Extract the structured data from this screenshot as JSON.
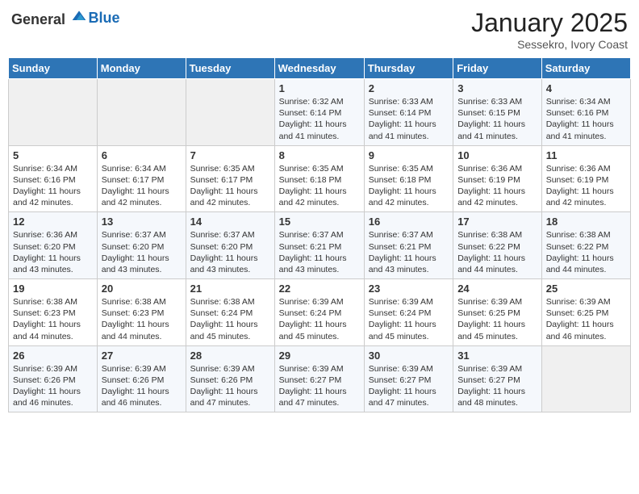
{
  "header": {
    "logo_general": "General",
    "logo_blue": "Blue",
    "month": "January 2025",
    "location": "Sessekro, Ivory Coast"
  },
  "weekdays": [
    "Sunday",
    "Monday",
    "Tuesday",
    "Wednesday",
    "Thursday",
    "Friday",
    "Saturday"
  ],
  "weeks": [
    [
      {
        "day": "",
        "info": ""
      },
      {
        "day": "",
        "info": ""
      },
      {
        "day": "",
        "info": ""
      },
      {
        "day": "1",
        "info": "Sunrise: 6:32 AM\nSunset: 6:14 PM\nDaylight: 11 hours and 41 minutes."
      },
      {
        "day": "2",
        "info": "Sunrise: 6:33 AM\nSunset: 6:14 PM\nDaylight: 11 hours and 41 minutes."
      },
      {
        "day": "3",
        "info": "Sunrise: 6:33 AM\nSunset: 6:15 PM\nDaylight: 11 hours and 41 minutes."
      },
      {
        "day": "4",
        "info": "Sunrise: 6:34 AM\nSunset: 6:16 PM\nDaylight: 11 hours and 41 minutes."
      }
    ],
    [
      {
        "day": "5",
        "info": "Sunrise: 6:34 AM\nSunset: 6:16 PM\nDaylight: 11 hours and 42 minutes."
      },
      {
        "day": "6",
        "info": "Sunrise: 6:34 AM\nSunset: 6:17 PM\nDaylight: 11 hours and 42 minutes."
      },
      {
        "day": "7",
        "info": "Sunrise: 6:35 AM\nSunset: 6:17 PM\nDaylight: 11 hours and 42 minutes."
      },
      {
        "day": "8",
        "info": "Sunrise: 6:35 AM\nSunset: 6:18 PM\nDaylight: 11 hours and 42 minutes."
      },
      {
        "day": "9",
        "info": "Sunrise: 6:35 AM\nSunset: 6:18 PM\nDaylight: 11 hours and 42 minutes."
      },
      {
        "day": "10",
        "info": "Sunrise: 6:36 AM\nSunset: 6:19 PM\nDaylight: 11 hours and 42 minutes."
      },
      {
        "day": "11",
        "info": "Sunrise: 6:36 AM\nSunset: 6:19 PM\nDaylight: 11 hours and 42 minutes."
      }
    ],
    [
      {
        "day": "12",
        "info": "Sunrise: 6:36 AM\nSunset: 6:20 PM\nDaylight: 11 hours and 43 minutes."
      },
      {
        "day": "13",
        "info": "Sunrise: 6:37 AM\nSunset: 6:20 PM\nDaylight: 11 hours and 43 minutes."
      },
      {
        "day": "14",
        "info": "Sunrise: 6:37 AM\nSunset: 6:20 PM\nDaylight: 11 hours and 43 minutes."
      },
      {
        "day": "15",
        "info": "Sunrise: 6:37 AM\nSunset: 6:21 PM\nDaylight: 11 hours and 43 minutes."
      },
      {
        "day": "16",
        "info": "Sunrise: 6:37 AM\nSunset: 6:21 PM\nDaylight: 11 hours and 43 minutes."
      },
      {
        "day": "17",
        "info": "Sunrise: 6:38 AM\nSunset: 6:22 PM\nDaylight: 11 hours and 44 minutes."
      },
      {
        "day": "18",
        "info": "Sunrise: 6:38 AM\nSunset: 6:22 PM\nDaylight: 11 hours and 44 minutes."
      }
    ],
    [
      {
        "day": "19",
        "info": "Sunrise: 6:38 AM\nSunset: 6:23 PM\nDaylight: 11 hours and 44 minutes."
      },
      {
        "day": "20",
        "info": "Sunrise: 6:38 AM\nSunset: 6:23 PM\nDaylight: 11 hours and 44 minutes."
      },
      {
        "day": "21",
        "info": "Sunrise: 6:38 AM\nSunset: 6:24 PM\nDaylight: 11 hours and 45 minutes."
      },
      {
        "day": "22",
        "info": "Sunrise: 6:39 AM\nSunset: 6:24 PM\nDaylight: 11 hours and 45 minutes."
      },
      {
        "day": "23",
        "info": "Sunrise: 6:39 AM\nSunset: 6:24 PM\nDaylight: 11 hours and 45 minutes."
      },
      {
        "day": "24",
        "info": "Sunrise: 6:39 AM\nSunset: 6:25 PM\nDaylight: 11 hours and 45 minutes."
      },
      {
        "day": "25",
        "info": "Sunrise: 6:39 AM\nSunset: 6:25 PM\nDaylight: 11 hours and 46 minutes."
      }
    ],
    [
      {
        "day": "26",
        "info": "Sunrise: 6:39 AM\nSunset: 6:26 PM\nDaylight: 11 hours and 46 minutes."
      },
      {
        "day": "27",
        "info": "Sunrise: 6:39 AM\nSunset: 6:26 PM\nDaylight: 11 hours and 46 minutes."
      },
      {
        "day": "28",
        "info": "Sunrise: 6:39 AM\nSunset: 6:26 PM\nDaylight: 11 hours and 47 minutes."
      },
      {
        "day": "29",
        "info": "Sunrise: 6:39 AM\nSunset: 6:27 PM\nDaylight: 11 hours and 47 minutes."
      },
      {
        "day": "30",
        "info": "Sunrise: 6:39 AM\nSunset: 6:27 PM\nDaylight: 11 hours and 47 minutes."
      },
      {
        "day": "31",
        "info": "Sunrise: 6:39 AM\nSunset: 6:27 PM\nDaylight: 11 hours and 48 minutes."
      },
      {
        "day": "",
        "info": ""
      }
    ]
  ]
}
